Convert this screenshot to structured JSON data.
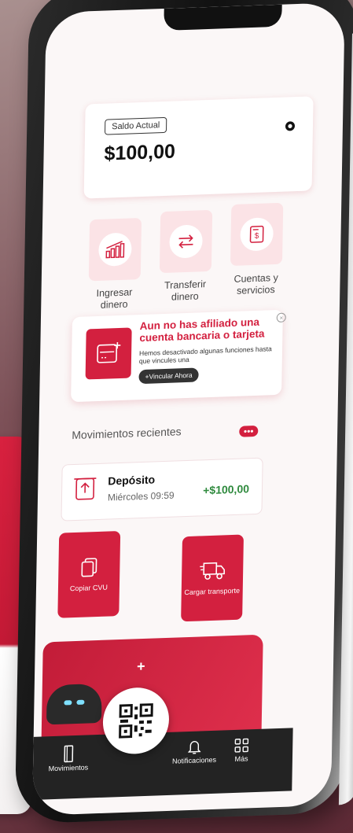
{
  "balance": {
    "label": "Saldo Actual",
    "amount": "$100,00"
  },
  "actions": [
    {
      "label_line1": "Ingresar",
      "label_line2": "dinero",
      "icon": "chart-growth-icon"
    },
    {
      "label_line1": "Transferir",
      "label_line2": "dinero",
      "icon": "transfer-arrows-icon"
    },
    {
      "label_line1": "Cuentas y",
      "label_line2": "servicios",
      "icon": "bill-document-icon"
    }
  ],
  "banner": {
    "title": "Aun no has afiliado una cuenta bancaria o tarjeta",
    "description": "Hemos desactivado algunas funciones hasta que vincules una",
    "button_label": "+Vincular Ahora"
  },
  "recent": {
    "title": "Movimientos recientes",
    "more": "•••",
    "items": [
      {
        "title": "Depósito",
        "date": "Miércoles 09:59",
        "amount": "+$100,00"
      }
    ]
  },
  "quick": {
    "copy_cvu": "Copiar CVU",
    "cargar_transporte": "Cargar transporte"
  },
  "promo": {
    "plus": "+"
  },
  "nav": {
    "movimientos": "Movimientos",
    "notificaciones": "Notificaciones",
    "mas": "Más"
  },
  "colors": {
    "brand_red": "#d3203f",
    "positive_green": "#2f8a3e",
    "tile_bg": "#fbe3e6"
  }
}
